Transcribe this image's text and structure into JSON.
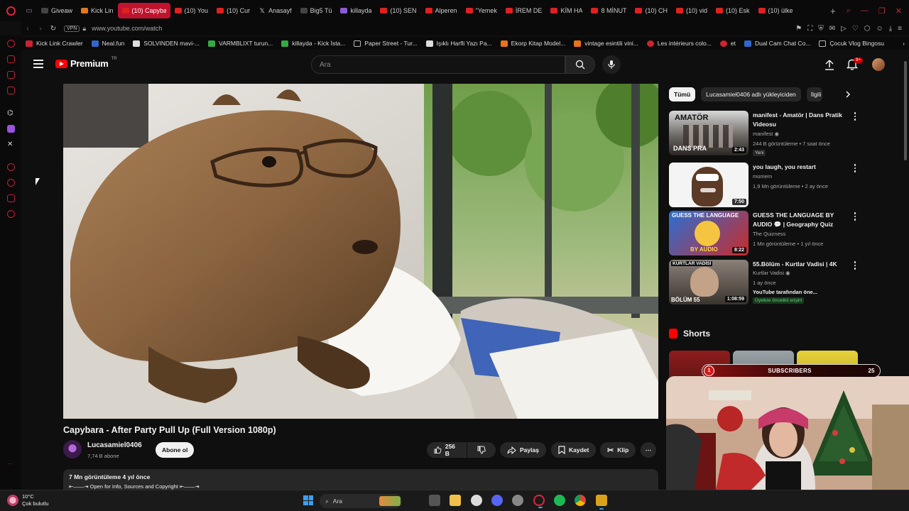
{
  "browser": {
    "tabs": [
      {
        "label": "Giveaw",
        "fav": "discord-icon",
        "style": "dark"
      },
      {
        "label": "Kick Lin",
        "fav": "kick-icon",
        "style": "orange"
      },
      {
        "label": "(10) Capyba",
        "fav": "youtube-icon",
        "style": "red",
        "active": true
      },
      {
        "label": "(10) You",
        "fav": "youtube-icon",
        "style": "red"
      },
      {
        "label": "(10) Cur",
        "fav": "youtube-icon",
        "style": "red"
      },
      {
        "label": "Anasayf",
        "fav": "x-icon",
        "style": "x"
      },
      {
        "label": "Big5 Tü",
        "fav": "big5-icon",
        "style": "dark"
      },
      {
        "label": "killayda",
        "fav": "kick-icon",
        "style": "purple"
      },
      {
        "label": "(10) SEN",
        "fav": "youtube-icon",
        "style": "red"
      },
      {
        "label": "Alperen",
        "fav": "youtube-icon",
        "style": "red"
      },
      {
        "label": "\"Yemek",
        "fav": "youtube-icon",
        "style": "red"
      },
      {
        "label": "İREM DE",
        "fav": "youtube-icon",
        "style": "red"
      },
      {
        "label": "KİM HA",
        "fav": "youtube-icon",
        "style": "red"
      },
      {
        "label": "8 MİNUT",
        "fav": "youtube-icon",
        "style": "red"
      },
      {
        "label": "(10) CH",
        "fav": "youtube-icon",
        "style": "red"
      },
      {
        "label": "(10) vid",
        "fav": "youtube-icon",
        "style": "red"
      },
      {
        "label": "(10) Esk",
        "fav": "youtube-icon",
        "style": "red"
      },
      {
        "label": "(10) ülke",
        "fav": "youtube-icon",
        "style": "red"
      }
    ],
    "vpn_label": "VPN",
    "url": "www.youtube.com/watch",
    "bookmarks": [
      {
        "label": "Kick Link Crawler",
        "style": ""
      },
      {
        "label": "Neal.fun",
        "style": "blue"
      },
      {
        "label": "SOLVINDEN mavi-...",
        "style": "white"
      },
      {
        "label": "VARMBLIXT turun...",
        "style": "green"
      },
      {
        "label": "killayda - Kick İsta...",
        "style": "green"
      },
      {
        "label": "Paper Street - Tur...",
        "style": "file"
      },
      {
        "label": "Işıklı Harfli Yazı Pa...",
        "style": "white"
      },
      {
        "label": "Ekorp Kitap Model...",
        "style": "orange"
      },
      {
        "label": "vintage esintili vini...",
        "style": "orange"
      },
      {
        "label": "Les intérieurs colo...",
        "style": "pin"
      },
      {
        "label": "et",
        "style": "pin"
      },
      {
        "label": "Dual Cam Chat Co...",
        "style": "blue"
      },
      {
        "label": "Çocuk Vlog Bingosu",
        "style": "file"
      }
    ]
  },
  "youtube": {
    "brand": "Premium",
    "brand_region": "TR",
    "search_placeholder": "Ara",
    "notification_count": "9+",
    "video": {
      "title": "Capybara - After Party Pull Up (Full Version 1080p)",
      "channel": "Lucasamiel0406",
      "subscribers": "7,74 B abone",
      "subscribe_label": "Abone ol",
      "likes": "256 B",
      "share_label": "Paylaş",
      "save_label": "Kaydet",
      "clip_label": "Klip",
      "views_age": "7 Mn görüntüleme  4 yıl önce",
      "description_line": "⇤——⇥ Open for Info, Sources and Copyright ⇤——⇥"
    },
    "chips": [
      "Tümü",
      "Lucasamiel0406 adlı yükleyiciden",
      "İlgili"
    ],
    "recommendations": [
      {
        "title": "manifest - Amatör | Dans Pratik Videosu",
        "channel": "manifest",
        "meta": "244 B görüntüleme • 7 saat önce",
        "badge": "Yeni",
        "duration": "2:43",
        "thumb_text": "AMATÖR"
      },
      {
        "title": "you laugh, you restart",
        "channel": "momem",
        "meta": "1,9 Mn görüntüleme • 2 ay önce",
        "duration": "7:50"
      },
      {
        "title": "GUESS THE LANGUAGE BY AUDIO 💬 | Geography Quiz",
        "channel": "The Quizness",
        "meta": "1 Mn görüntüleme • 1 yıl önce",
        "duration": "8:22",
        "thumb_text": "GUESS THE LANGUAGE",
        "thumb_sub": "BY AUDIO"
      },
      {
        "title": "55.Bölüm - Kurtlar Vadisi | 4K",
        "channel": "Kurtlar Vadisi",
        "meta": "1 ay önce",
        "extra": "YouTube tarafından öne...",
        "badge": "Üyelere öncelikli erişim",
        "duration": "1:08:59",
        "thumb_text": "KURTLAR VADİSİ",
        "thumb_sub": "BÖLÜM 55"
      }
    ],
    "shorts_title": "Shorts"
  },
  "overlay": {
    "subs_left": "1",
    "subs_label": "SUBSCRIBERS",
    "subs_right": "25"
  },
  "taskbar": {
    "temperature": "10°C",
    "weather": "Çok bulutlu",
    "search_label": "Ara"
  }
}
